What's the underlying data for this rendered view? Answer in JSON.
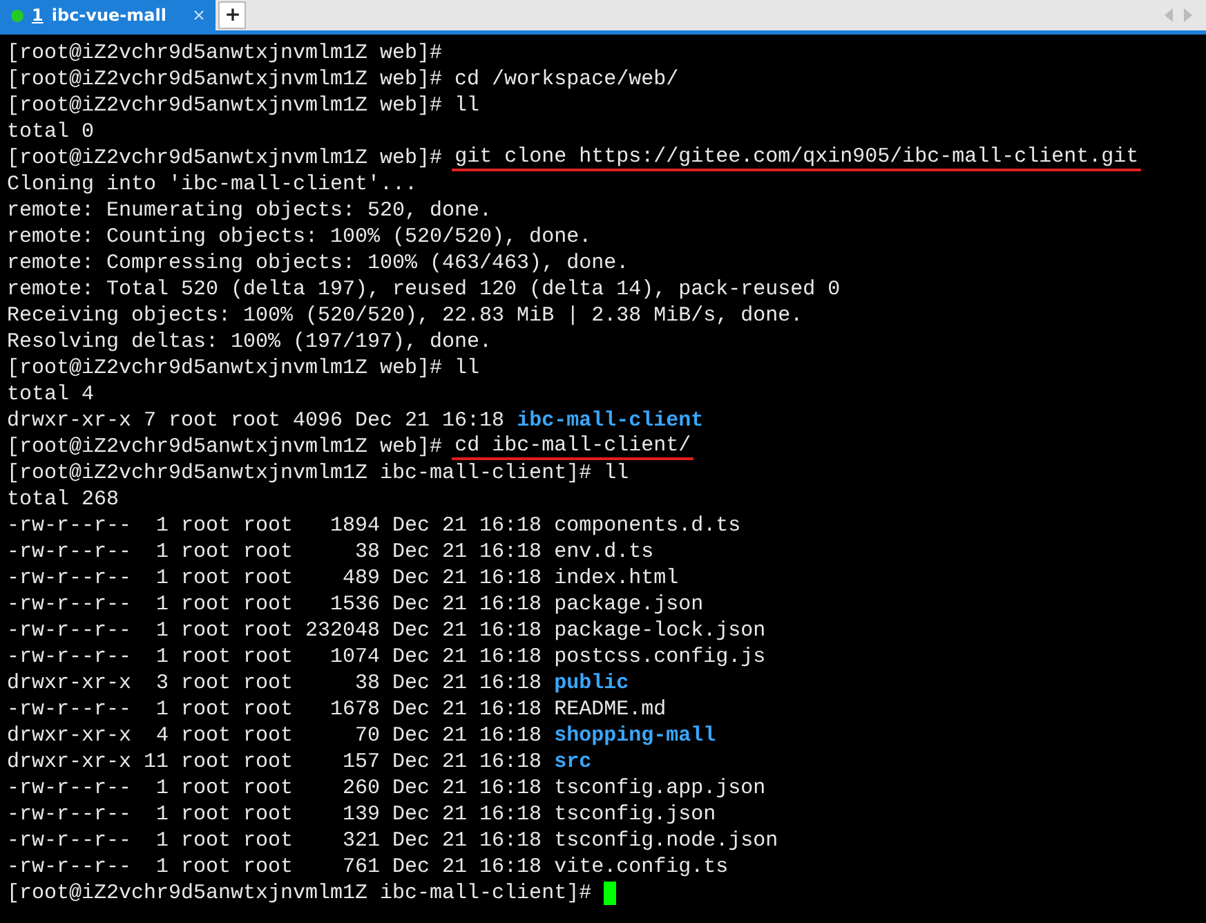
{
  "tabs": [
    {
      "number": "1",
      "title": "ibc-vue-mall",
      "selected": true,
      "color": "#22cc22"
    }
  ],
  "new_tab": "+",
  "terminal": {
    "lines": [
      {
        "segments": [
          {
            "kind": "plain",
            "text": "[root@iZ2vchr9d5anwtxjnvmlm1Z web]#"
          }
        ]
      },
      {
        "segments": [
          {
            "kind": "plain",
            "text": "[root@iZ2vchr9d5anwtxjnvmlm1Z web]# cd /workspace/web/"
          }
        ]
      },
      {
        "segments": [
          {
            "kind": "plain",
            "text": "[root@iZ2vchr9d5anwtxjnvmlm1Z web]# ll"
          }
        ]
      },
      {
        "segments": [
          {
            "kind": "plain",
            "text": "total 0"
          }
        ]
      },
      {
        "segments": [
          {
            "kind": "plain",
            "text": "[root@iZ2vchr9d5anwtxjnvmlm1Z web]# "
          },
          {
            "kind": "marked",
            "text": "git clone https://gitee.com/qxin905/ibc-mall-client.git"
          }
        ]
      },
      {
        "segments": [
          {
            "kind": "plain",
            "text": "Cloning into 'ibc-mall-client'..."
          }
        ]
      },
      {
        "segments": [
          {
            "kind": "plain",
            "text": "remote: Enumerating objects: 520, done."
          }
        ]
      },
      {
        "segments": [
          {
            "kind": "plain",
            "text": "remote: Counting objects: 100% (520/520), done."
          }
        ]
      },
      {
        "segments": [
          {
            "kind": "plain",
            "text": "remote: Compressing objects: 100% (463/463), done."
          }
        ]
      },
      {
        "segments": [
          {
            "kind": "plain",
            "text": "remote: Total 520 (delta 197), reused 120 (delta 14), pack-reused 0"
          }
        ]
      },
      {
        "segments": [
          {
            "kind": "plain",
            "text": "Receiving objects: 100% (520/520), 22.83 MiB | 2.38 MiB/s, done."
          }
        ]
      },
      {
        "segments": [
          {
            "kind": "plain",
            "text": "Resolving deltas: 100% (197/197), done."
          }
        ]
      },
      {
        "segments": [
          {
            "kind": "plain",
            "text": "[root@iZ2vchr9d5anwtxjnvmlm1Z web]# ll"
          }
        ]
      },
      {
        "segments": [
          {
            "kind": "plain",
            "text": "total 4"
          }
        ]
      },
      {
        "segments": [
          {
            "kind": "plain",
            "text": "drwxr-xr-x 7 root root 4096 Dec 21 16:18 "
          },
          {
            "kind": "directory",
            "text": "ibc-mall-client"
          }
        ]
      },
      {
        "segments": [
          {
            "kind": "plain",
            "text": "[root@iZ2vchr9d5anwtxjnvmlm1Z web]# "
          },
          {
            "kind": "marked",
            "text": "cd ibc-mall-client/"
          }
        ]
      },
      {
        "segments": [
          {
            "kind": "plain",
            "text": "[root@iZ2vchr9d5anwtxjnvmlm1Z ibc-mall-client]# ll"
          }
        ]
      },
      {
        "segments": [
          {
            "kind": "plain",
            "text": "total 268"
          }
        ]
      },
      {
        "segments": [
          {
            "kind": "plain",
            "text": "-rw-r--r--  1 root root   1894 Dec 21 16:18 components.d.ts"
          }
        ]
      },
      {
        "segments": [
          {
            "kind": "plain",
            "text": "-rw-r--r--  1 root root     38 Dec 21 16:18 env.d.ts"
          }
        ]
      },
      {
        "segments": [
          {
            "kind": "plain",
            "text": "-rw-r--r--  1 root root    489 Dec 21 16:18 index.html"
          }
        ]
      },
      {
        "segments": [
          {
            "kind": "plain",
            "text": "-rw-r--r--  1 root root   1536 Dec 21 16:18 package.json"
          }
        ]
      },
      {
        "segments": [
          {
            "kind": "plain",
            "text": "-rw-r--r--  1 root root 232048 Dec 21 16:18 package-lock.json"
          }
        ]
      },
      {
        "segments": [
          {
            "kind": "plain",
            "text": "-rw-r--r--  1 root root   1074 Dec 21 16:18 postcss.config.js"
          }
        ]
      },
      {
        "segments": [
          {
            "kind": "plain",
            "text": "drwxr-xr-x  3 root root     38 Dec 21 16:18 "
          },
          {
            "kind": "directory",
            "text": "public"
          }
        ]
      },
      {
        "segments": [
          {
            "kind": "plain",
            "text": "-rw-r--r--  1 root root   1678 Dec 21 16:18 README.md"
          }
        ]
      },
      {
        "segments": [
          {
            "kind": "plain",
            "text": "drwxr-xr-x  4 root root     70 Dec 21 16:18 "
          },
          {
            "kind": "directory",
            "text": "shopping-mall"
          }
        ]
      },
      {
        "segments": [
          {
            "kind": "plain",
            "text": "drwxr-xr-x 11 root root    157 Dec 21 16:18 "
          },
          {
            "kind": "directory",
            "text": "src"
          }
        ]
      },
      {
        "segments": [
          {
            "kind": "plain",
            "text": "-rw-r--r--  1 root root    260 Dec 21 16:18 tsconfig.app.json"
          }
        ]
      },
      {
        "segments": [
          {
            "kind": "plain",
            "text": "-rw-r--r--  1 root root    139 Dec 21 16:18 tsconfig.json"
          }
        ]
      },
      {
        "segments": [
          {
            "kind": "plain",
            "text": "-rw-r--r--  1 root root    321 Dec 21 16:18 tsconfig.node.json"
          }
        ]
      },
      {
        "segments": [
          {
            "kind": "plain",
            "text": "-rw-r--r--  1 root root    761 Dec 21 16:18 vite.config.ts"
          }
        ]
      },
      {
        "segments": [
          {
            "kind": "plain",
            "text": "[root@iZ2vchr9d5anwtxjnvmlm1Z ibc-mall-client]# "
          }
        ],
        "cursor": true
      }
    ]
  }
}
